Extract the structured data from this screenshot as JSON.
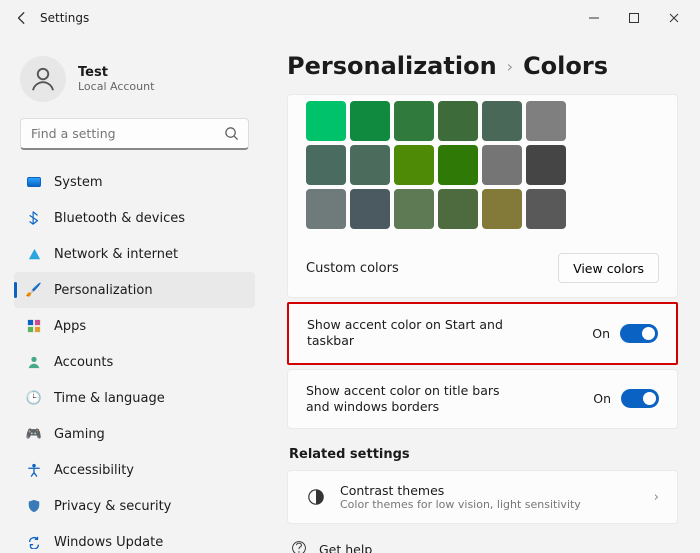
{
  "window": {
    "title": "Settings"
  },
  "user": {
    "name": "Test",
    "subtitle": "Local Account"
  },
  "search": {
    "placeholder": "Find a setting"
  },
  "nav": {
    "items": [
      {
        "label": "System",
        "icon": "🖥️"
      },
      {
        "label": "Bluetooth & devices",
        "icon": "bt"
      },
      {
        "label": "Network & internet",
        "icon": "wifi"
      },
      {
        "label": "Personalization",
        "icon": "🖌️"
      },
      {
        "label": "Apps",
        "icon": "apps"
      },
      {
        "label": "Accounts",
        "icon": "👤"
      },
      {
        "label": "Time & language",
        "icon": "⏱️"
      },
      {
        "label": "Gaming",
        "icon": "🎮"
      },
      {
        "label": "Accessibility",
        "icon": "acc"
      },
      {
        "label": "Privacy & security",
        "icon": "🛡️"
      },
      {
        "label": "Windows Update",
        "icon": "upd"
      }
    ],
    "active_index": 3
  },
  "breadcrumb": {
    "parent": "Personalization",
    "current": "Colors"
  },
  "swatches": [
    [
      "#00c26a",
      "#0f8a3f",
      "#2f7a3c",
      "#3e6b3a",
      "#4a6857",
      "#7f7f7f"
    ],
    [
      "#4a6b60",
      "#4b6b5c",
      "#4f8a07",
      "#2f7a07",
      "#757575",
      "#454545"
    ],
    [
      "#6f7a7a",
      "#4a5a60",
      "#5e7a54",
      "#4e6a3f",
      "#837a3a",
      "#595959"
    ]
  ],
  "custom": {
    "label": "Custom colors",
    "button": "View colors"
  },
  "options": {
    "start_taskbar": {
      "label": "Show accent color on Start and taskbar",
      "state": "On"
    },
    "title_borders": {
      "label": "Show accent color on title bars and windows borders",
      "state": "On"
    }
  },
  "related": {
    "heading": "Related settings",
    "contrast": {
      "title": "Contrast themes",
      "subtitle": "Color themes for low vision, light sensitivity"
    }
  },
  "help": {
    "label": "Get help"
  }
}
